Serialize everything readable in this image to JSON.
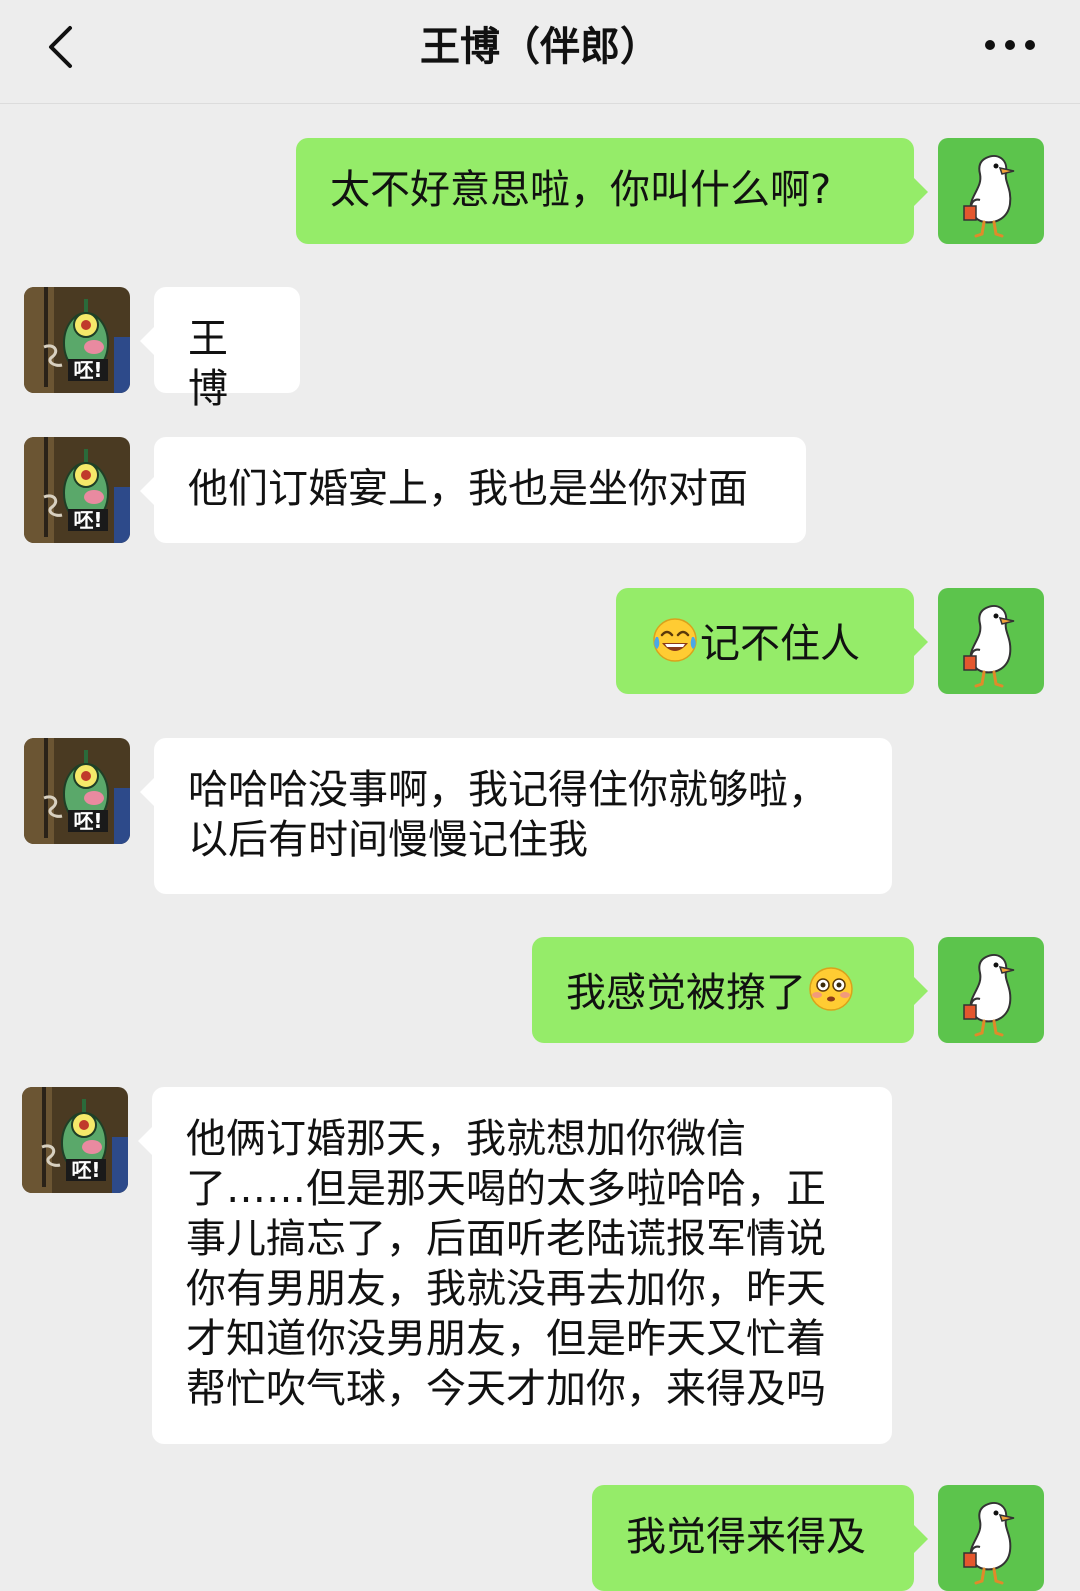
{
  "header": {
    "title": "王博（伴郎）"
  },
  "colors": {
    "background": "#ededed",
    "self_bubble": "#95ec69",
    "other_bubble": "#ffffff"
  },
  "icons": {
    "back": "chevron-left-icon",
    "more": "more-dots-icon",
    "emoji_laugh": "tears-of-joy-emoji",
    "emoji_flushed": "flushed-face-emoji"
  },
  "avatars": {
    "self": "white-duck-avatar",
    "other": "green-plankton-avatar",
    "other_caption": "呸!"
  },
  "messages": [
    {
      "sender": "self",
      "text": "太不好意思啦，你叫什么啊?"
    },
    {
      "sender": "other",
      "text": "王博"
    },
    {
      "sender": "other",
      "text": "他们订婚宴上，我也是坐你对面"
    },
    {
      "sender": "self",
      "text": "记不住人"
    },
    {
      "sender": "other",
      "text": "哈哈哈没事啊，我记得住你就够啦，以后有时间慢慢记住我"
    },
    {
      "sender": "self",
      "text": "我感觉被撩了"
    },
    {
      "sender": "other",
      "text": "他俩订婚那天，我就想加你微信了……但是那天喝的太多啦哈哈，正事儿搞忘了，后面听老陆谎报军情说你有男朋友，我就没再去加你，昨天才知道你没男朋友，但是昨天又忙着帮忙吹气球，今天才加你，来得及吗"
    },
    {
      "sender": "self",
      "text": "我觉得来得及"
    }
  ]
}
